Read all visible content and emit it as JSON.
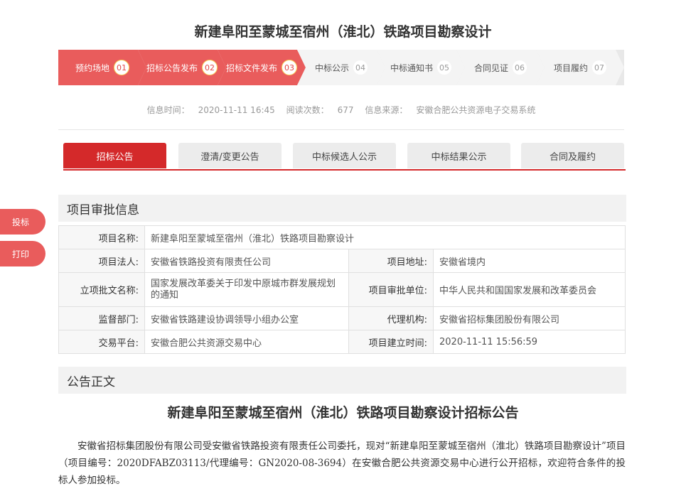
{
  "title": "新建阜阳至蒙城至宿州（淮北）铁路项目勘察设计",
  "steps": [
    {
      "label": "预约场地",
      "num": "01",
      "active": true
    },
    {
      "label": "招标公告发布",
      "num": "02",
      "active": true
    },
    {
      "label": "招标文件发布",
      "num": "03",
      "active": true
    },
    {
      "label": "中标公示",
      "num": "04",
      "active": false
    },
    {
      "label": "中标通知书",
      "num": "05",
      "active": false
    },
    {
      "label": "合同见证",
      "num": "06",
      "active": false
    },
    {
      "label": "项目履约",
      "num": "07",
      "active": false
    }
  ],
  "info": {
    "time_label": "信息时间：",
    "time_value": "2020-11-11 16:45",
    "reads_label": "阅读次数：",
    "reads_value": "677",
    "source_label": "信息来源：",
    "source_value": "安徽合肥公共资源电子交易系统"
  },
  "tabs": [
    "招标公告",
    "澄清/变更公告",
    "中标候选人公示",
    "中标结果公示",
    "合同及履约"
  ],
  "side_buttons": {
    "bid": "投标",
    "print": "打印"
  },
  "approval": {
    "heading": "项目审批信息",
    "project_name_label": "项目名称:",
    "project_name": "新建阜阳至蒙城至宿州（淮北）铁路项目勘察设计",
    "legal_label": "项目法人:",
    "legal": "安徽省铁路投资有限责任公司",
    "address_label": "项目地址:",
    "address": "安徽省境内",
    "doc_label": "立项批文名称:",
    "doc": "国家发展改革委关于印发中原城市群发展规划的通知",
    "unit_label": "项目审批单位:",
    "unit": "中华人民共和国国家发展和改革委员会",
    "supervisor_label": "监督部门:",
    "supervisor": "安徽省铁路建设协调领导小组办公室",
    "agency_label": "代理机构:",
    "agency": "安徽省招标集团股份有限公司",
    "platform_label": "交易平台:",
    "platform": "安徽合肥公共资源交易中心",
    "created_label": "项目建立时间:",
    "created": "2020-11-11 15:56:59"
  },
  "notice": {
    "heading": "公告正文",
    "title": "新建阜阳至蒙城至宿州（淮北）铁路项目勘察设计招标公告",
    "body": "安徽省招标集团股份有限公司受安徽省铁路投资有限责任公司委托，现对“新建阜阳至蒙城至宿州（淮北）铁路项目勘察设计”项目（项目编号：2020DFABZ03113/代理编号：GN2020-08-3694）在安徽合肥公共资源交易中心进行公开招标，欢迎符合条件的投标人参加投标。"
  }
}
